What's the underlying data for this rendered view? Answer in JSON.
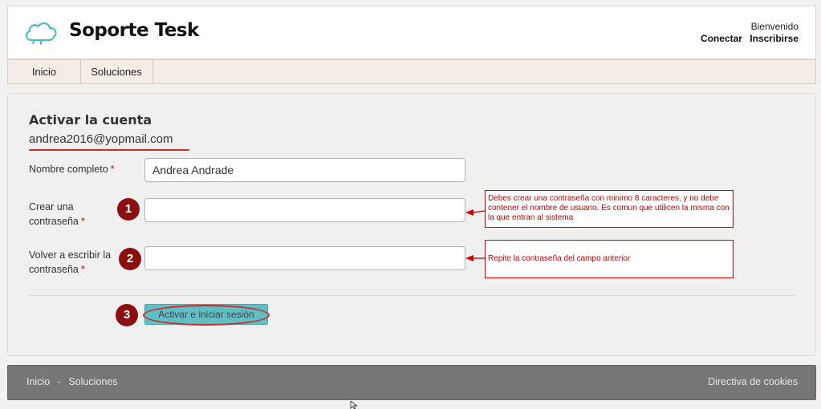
{
  "header": {
    "site_name": "Soporte Tesk",
    "welcome": "Bienvenido",
    "login_link": "Conectar",
    "register_link": "Inscribirse",
    "logo_icon": "cloud-logo-icon"
  },
  "nav": {
    "items": [
      {
        "label": "Inicio"
      },
      {
        "label": "Soluciones"
      }
    ]
  },
  "form": {
    "title": "Activar la cuenta",
    "email": "andrea2016@yopmail.com",
    "full_name_label": "Nombre completo",
    "full_name_value": "Andrea Andrade",
    "password_label_line1": "Crear una",
    "password_label_line2": "contraseña",
    "password_value": "",
    "confirm_label_line1": "Volver a escribir la",
    "confirm_label_line2": "contraseña",
    "confirm_value": "",
    "required_mark": "*",
    "submit_label": "Activar e iniciar sesión"
  },
  "annotations": {
    "steps": [
      "1",
      "2",
      "3"
    ],
    "note_password": "Debes crear una contraseña con minimo 8 caracteres, y no debe contener el nombre de usuario. Es comun que utilicen la misma con la que entran al sistema",
    "note_confirm": "Repite la contraseña del campo anterior",
    "accent_color": "#8b0f10",
    "highlight_color": "#d42a2a"
  },
  "footer": {
    "link_home": "Inicio",
    "separator": "-",
    "link_solutions": "Soluciones",
    "cookies": "Directiva de cookies"
  }
}
